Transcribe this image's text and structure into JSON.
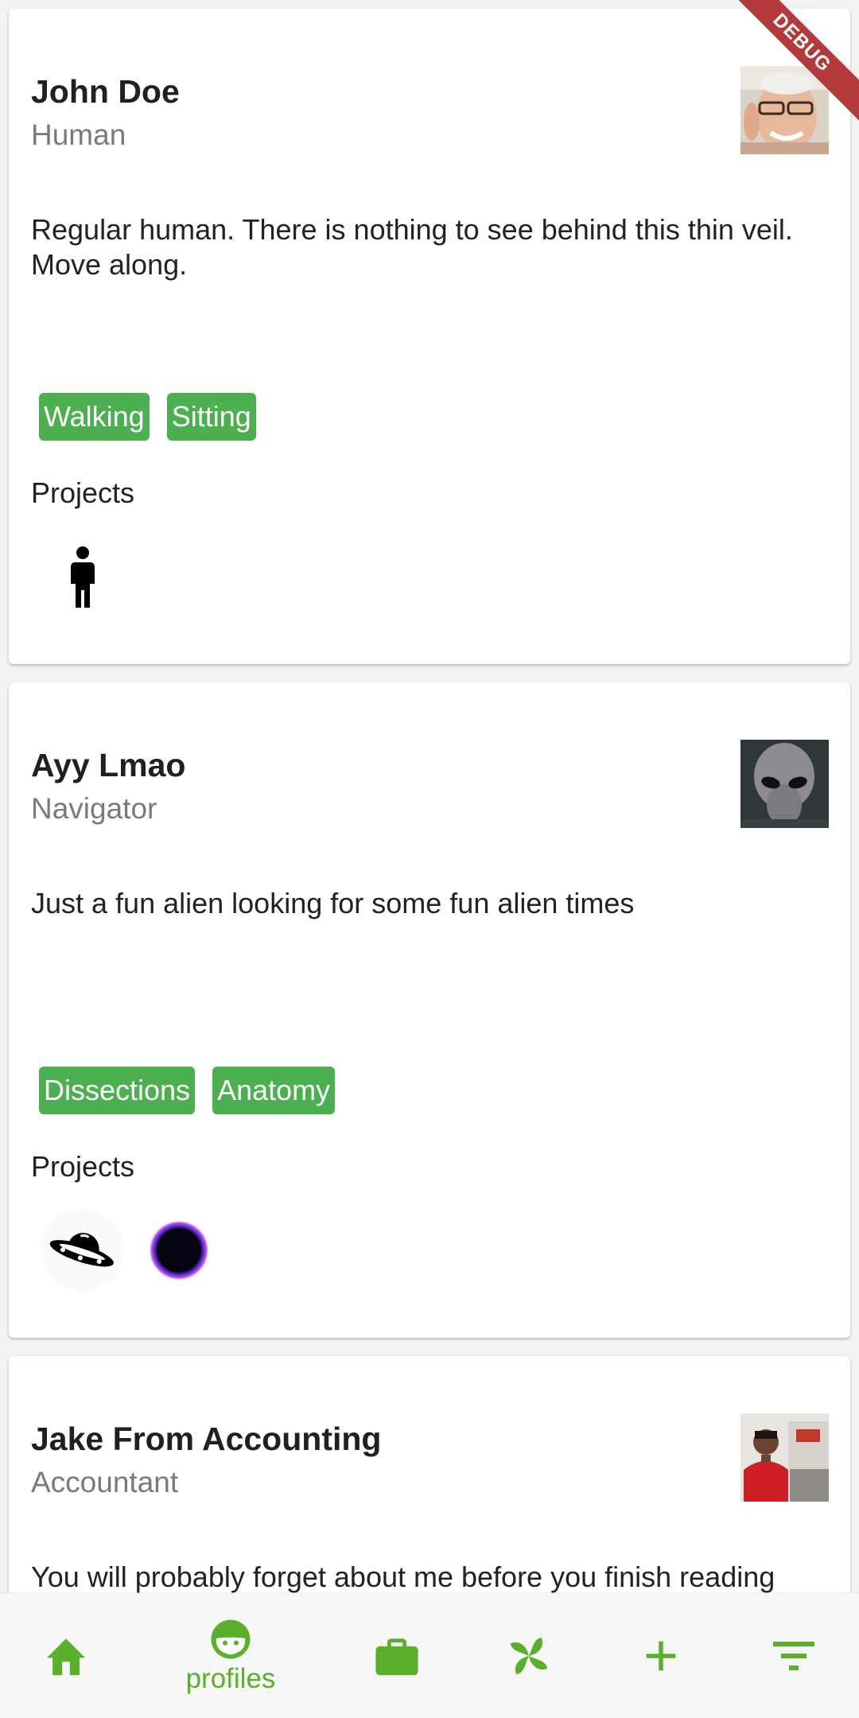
{
  "debug_banner": "DEBUG",
  "profiles": [
    {
      "name": "John Doe",
      "role": "Human",
      "bio": "Regular human. There is nothing to see behind this thin veil. Move along.",
      "tags": [
        "Walking",
        "Sitting"
      ],
      "projects_label": "Projects",
      "projects": [
        "person-icon"
      ]
    },
    {
      "name": "Ayy Lmao",
      "role": "Navigator",
      "bio": "Just a fun alien looking for some fun alien times",
      "tags": [
        "Dissections",
        "Anatomy"
      ],
      "projects_label": "Projects",
      "projects": [
        "ufo-icon",
        "black-hole-icon"
      ]
    },
    {
      "name": "Jake From Accounting",
      "role": "Accountant",
      "bio": "You will probably forget about me before you finish reading"
    }
  ],
  "bottom_nav": {
    "items": [
      "home-icon",
      "profiles-icon",
      "briefcase-icon",
      "pinwheel-icon",
      "add-icon",
      "filter-icon"
    ],
    "active_label": "profiles",
    "accent_color": "#5ab02a"
  },
  "tag_color": "#4caf50"
}
